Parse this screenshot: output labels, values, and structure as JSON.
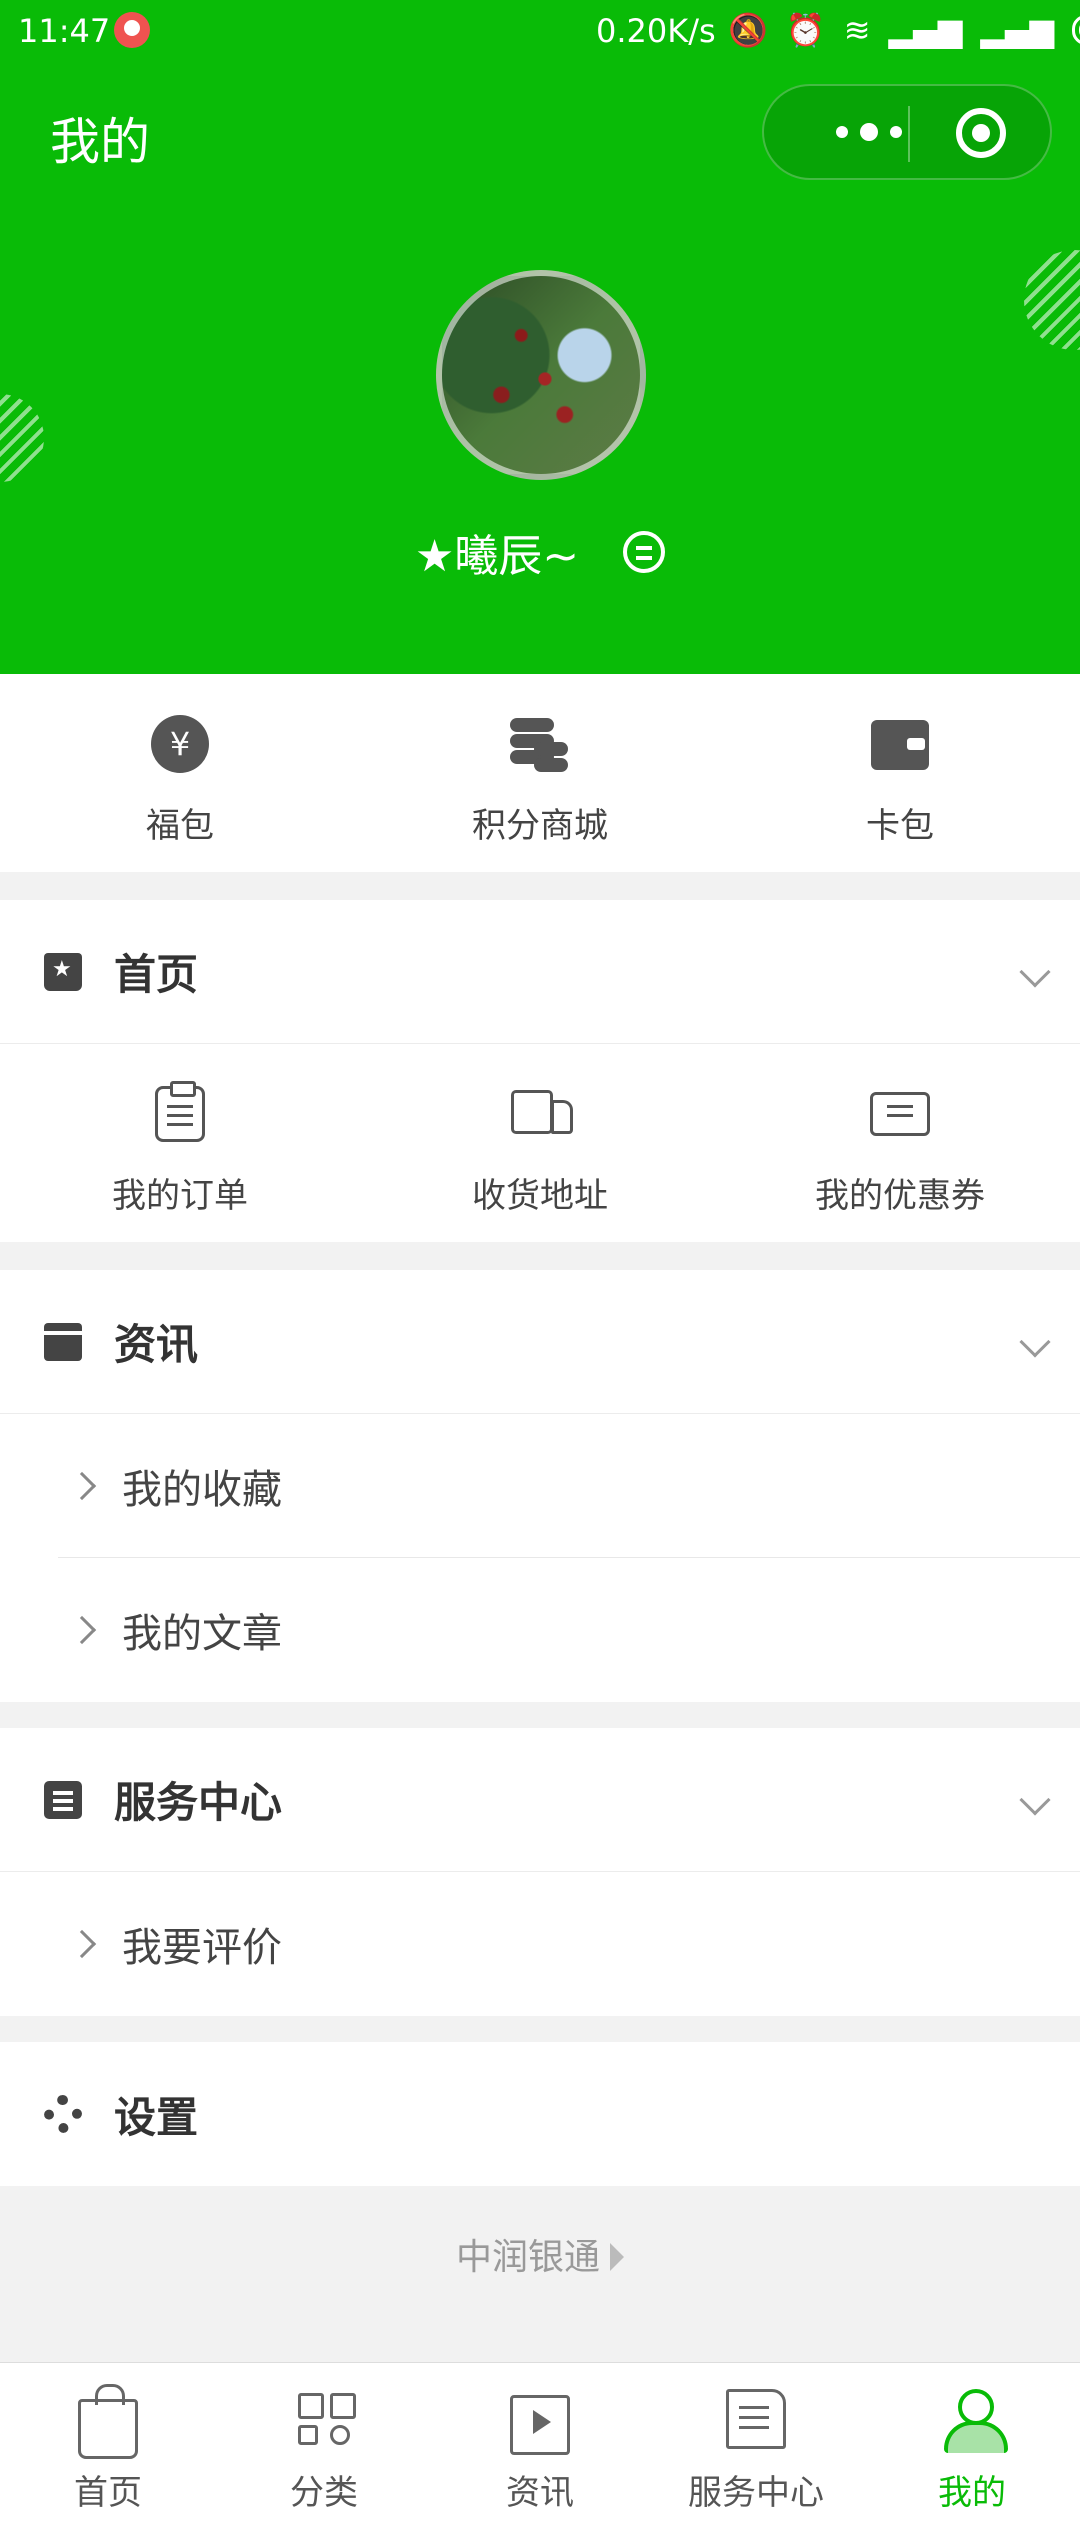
{
  "status_bar": {
    "time": "11:47",
    "speed": "0.20K/s"
  },
  "header": {
    "title": "我的"
  },
  "profile": {
    "nickname": "★曦辰~"
  },
  "quick_actions": [
    {
      "label": "福包",
      "icon": "yen-coin-icon"
    },
    {
      "label": "积分商城",
      "icon": "coin-stack-icon"
    },
    {
      "label": "卡包",
      "icon": "wallet-icon"
    }
  ],
  "sections": {
    "home": {
      "title": "首页",
      "items": [
        {
          "label": "我的订单",
          "icon": "clipboard-icon"
        },
        {
          "label": "收货地址",
          "icon": "truck-icon"
        },
        {
          "label": "我的优惠券",
          "icon": "ticket-icon"
        }
      ]
    },
    "news": {
      "title": "资讯",
      "items": [
        "我的收藏",
        "我的文章"
      ]
    },
    "service": {
      "title": "服务中心",
      "items": [
        "我要评价"
      ]
    },
    "settings": {
      "title": "设置"
    }
  },
  "footer": {
    "brand": "中润银通"
  },
  "tabbar": {
    "tabs": [
      {
        "label": "首页",
        "icon": "shopping-bag-icon"
      },
      {
        "label": "分类",
        "icon": "category-grid-icon"
      },
      {
        "label": "资讯",
        "icon": "video-play-icon"
      },
      {
        "label": "服务中心",
        "icon": "notes-icon"
      },
      {
        "label": "我的",
        "icon": "user-icon",
        "active": true
      }
    ]
  },
  "colors": {
    "brand_green": "#09bb07",
    "background": "#f2f2f2"
  }
}
